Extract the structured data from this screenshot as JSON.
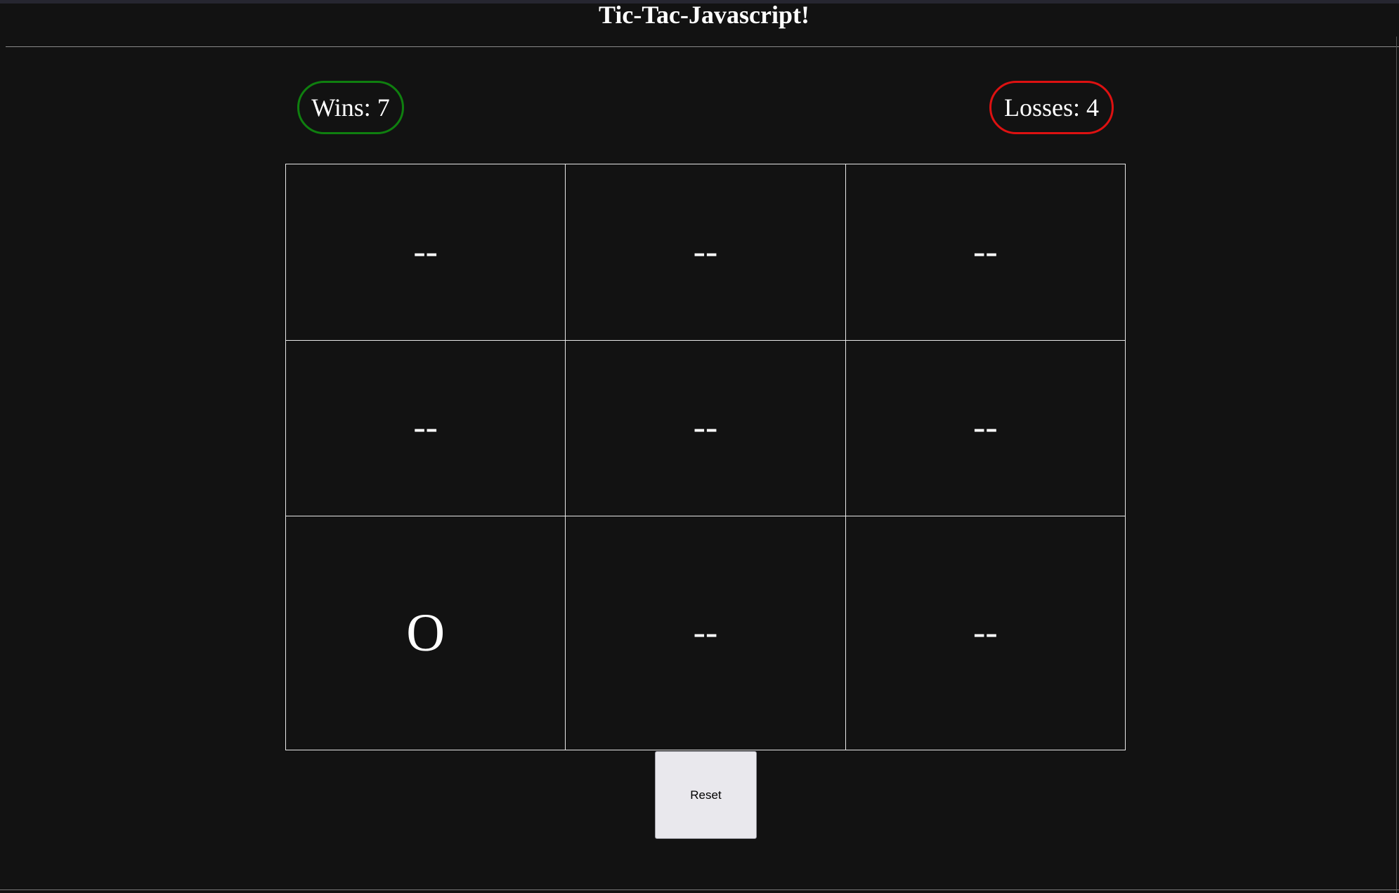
{
  "header": {
    "title": "Tic-Tac-Javascript!"
  },
  "scores": {
    "wins_label": "Wins: 7",
    "losses_label": "Losses: 4",
    "wins_color": "#0f7f0f",
    "losses_color": "#dd1111"
  },
  "board": {
    "rows": [
      [
        "--",
        "--",
        "--"
      ],
      [
        "--",
        "--",
        "--"
      ],
      [
        "O",
        "--",
        "--"
      ]
    ]
  },
  "controls": {
    "reset_label": "Reset"
  },
  "theme": {
    "background": "#121212",
    "text": "#ffffff",
    "grid_line": "#e8e8e8",
    "button_bg": "#e9e8ed"
  }
}
